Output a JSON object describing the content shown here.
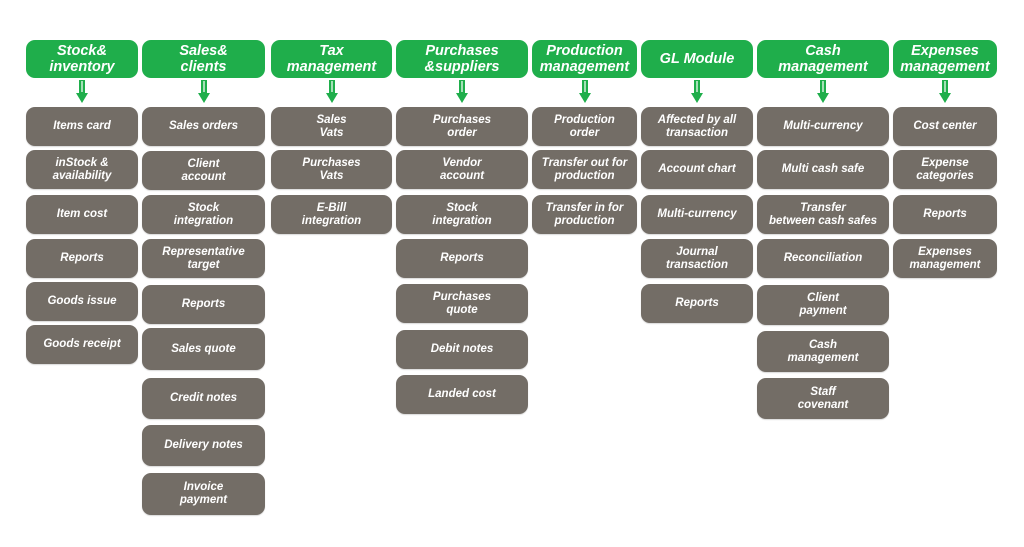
{
  "colors": {
    "header": "#1fae4b",
    "item": "#736d66",
    "text": "#ffffff"
  },
  "columns": [
    {
      "title": "Stock&\ninventory",
      "items": [
        "Items card",
        "inStock &\navailability",
        "Item cost",
        "Reports",
        "Goods issue",
        "Goods receipt"
      ]
    },
    {
      "title": "Sales&\nclients",
      "items": [
        "Sales orders",
        "Client\naccount",
        "Stock\nintegration",
        "Representative\ntarget",
        "Reports",
        "Sales quote",
        "Credit notes",
        "Delivery notes",
        "Invoice\npayment"
      ]
    },
    {
      "title": "Tax\nmanagement",
      "items": [
        "Sales\nVats",
        "Purchases\nVats",
        "E-Bill\nintegration"
      ]
    },
    {
      "title": "Purchases\n&suppliers",
      "items": [
        "Purchases\norder",
        "Vendor\naccount",
        "Stock\nintegration",
        "Reports",
        "Purchases\nquote",
        "Debit notes",
        "Landed cost"
      ]
    },
    {
      "title": "Production\nmanagement",
      "items": [
        "Production\norder",
        "Transfer out for\nproduction",
        "Transfer in for\nproduction"
      ]
    },
    {
      "title": "GL Module",
      "items": [
        "Affected by all\ntransaction",
        "Account chart",
        "Multi-currency",
        "Journal\ntransaction",
        "Reports"
      ]
    },
    {
      "title": "Cash\nmanagement",
      "items": [
        "Multi-currency",
        "Multi cash safe",
        "Transfer\nbetween cash safes",
        "Reconciliation",
        "Client\npayment",
        "Cash\nmanagement",
        "Staff\ncovenant"
      ]
    },
    {
      "title": "Expenses\nmanagement",
      "items": [
        "Cost center",
        "Expense\ncategories",
        "Reports",
        "Expenses\nmanagement"
      ]
    }
  ]
}
